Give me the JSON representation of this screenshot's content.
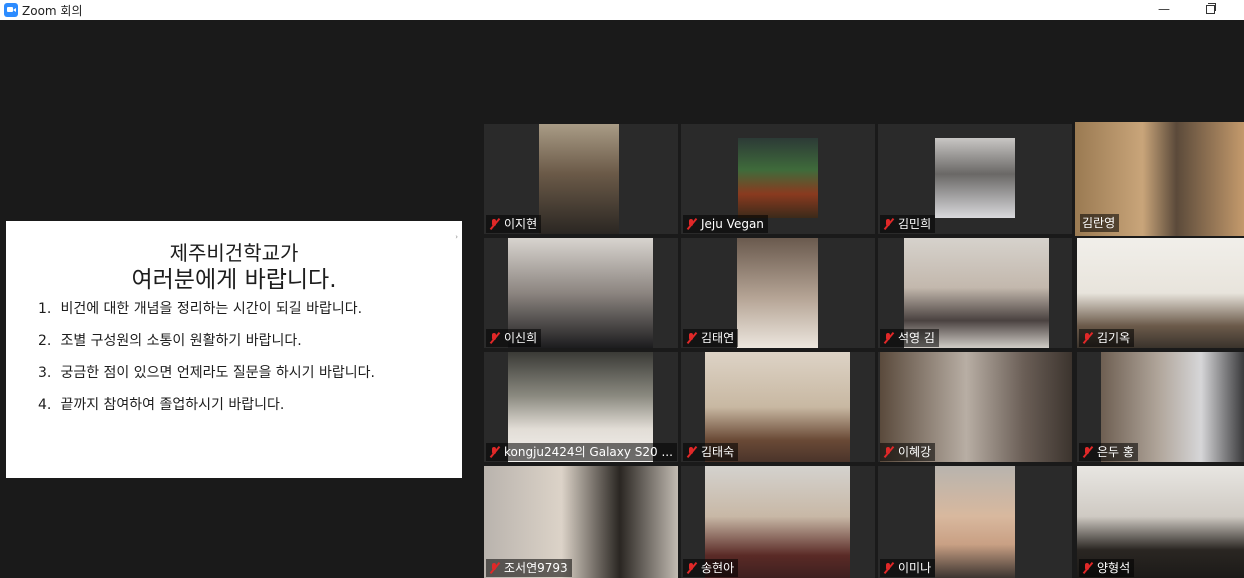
{
  "window": {
    "title": "Zoom 회의",
    "minimize": "—"
  },
  "share": {
    "heading1": "제주비건학교가",
    "heading2": "여러분에게 바랍니다.",
    "items": [
      {
        "num": "1.",
        "text": "비건에 대한 개념을 정리하는 시간이 되길 바랍니다."
      },
      {
        "num": "2.",
        "text": "조별 구성원의 소통이 원활하기 바랍니다."
      },
      {
        "num": "3.",
        "text": "궁금한 점이 있으면 언제라도 질문을 하시기 바랍니다."
      },
      {
        "num": "4.",
        "text": "끝까지 참여하여 졸업하시기 바랍니다."
      }
    ],
    "chevron": "›"
  },
  "participants": [
    {
      "name": "이지현",
      "muted": true
    },
    {
      "name": "Jeju Vegan",
      "muted": true
    },
    {
      "name": "김민희",
      "muted": true
    },
    {
      "name": "김란영",
      "muted": false,
      "active": true
    },
    {
      "name": "이신희",
      "muted": true
    },
    {
      "name": "김태연",
      "muted": true
    },
    {
      "name": "석영 김",
      "muted": true
    },
    {
      "name": "김기옥",
      "muted": true
    },
    {
      "name": "kongju2424의 Galaxy S20 ...",
      "muted": true
    },
    {
      "name": "김태숙",
      "muted": true
    },
    {
      "name": "이혜강",
      "muted": true
    },
    {
      "name": "은두 홍",
      "muted": true
    },
    {
      "name": "조서연9793",
      "muted": true
    },
    {
      "name": "송현아",
      "muted": true
    },
    {
      "name": "이미나",
      "muted": true
    },
    {
      "name": "양형석",
      "muted": true
    }
  ],
  "colors": {
    "active_border": "#c8e33a",
    "muted_mic": "#e02828",
    "background": "#1a1a1a"
  },
  "icons": {
    "app": "zoom-icon",
    "mute": "muted-mic-icon",
    "minimize": "minimize-icon",
    "restore": "restore-icon"
  }
}
